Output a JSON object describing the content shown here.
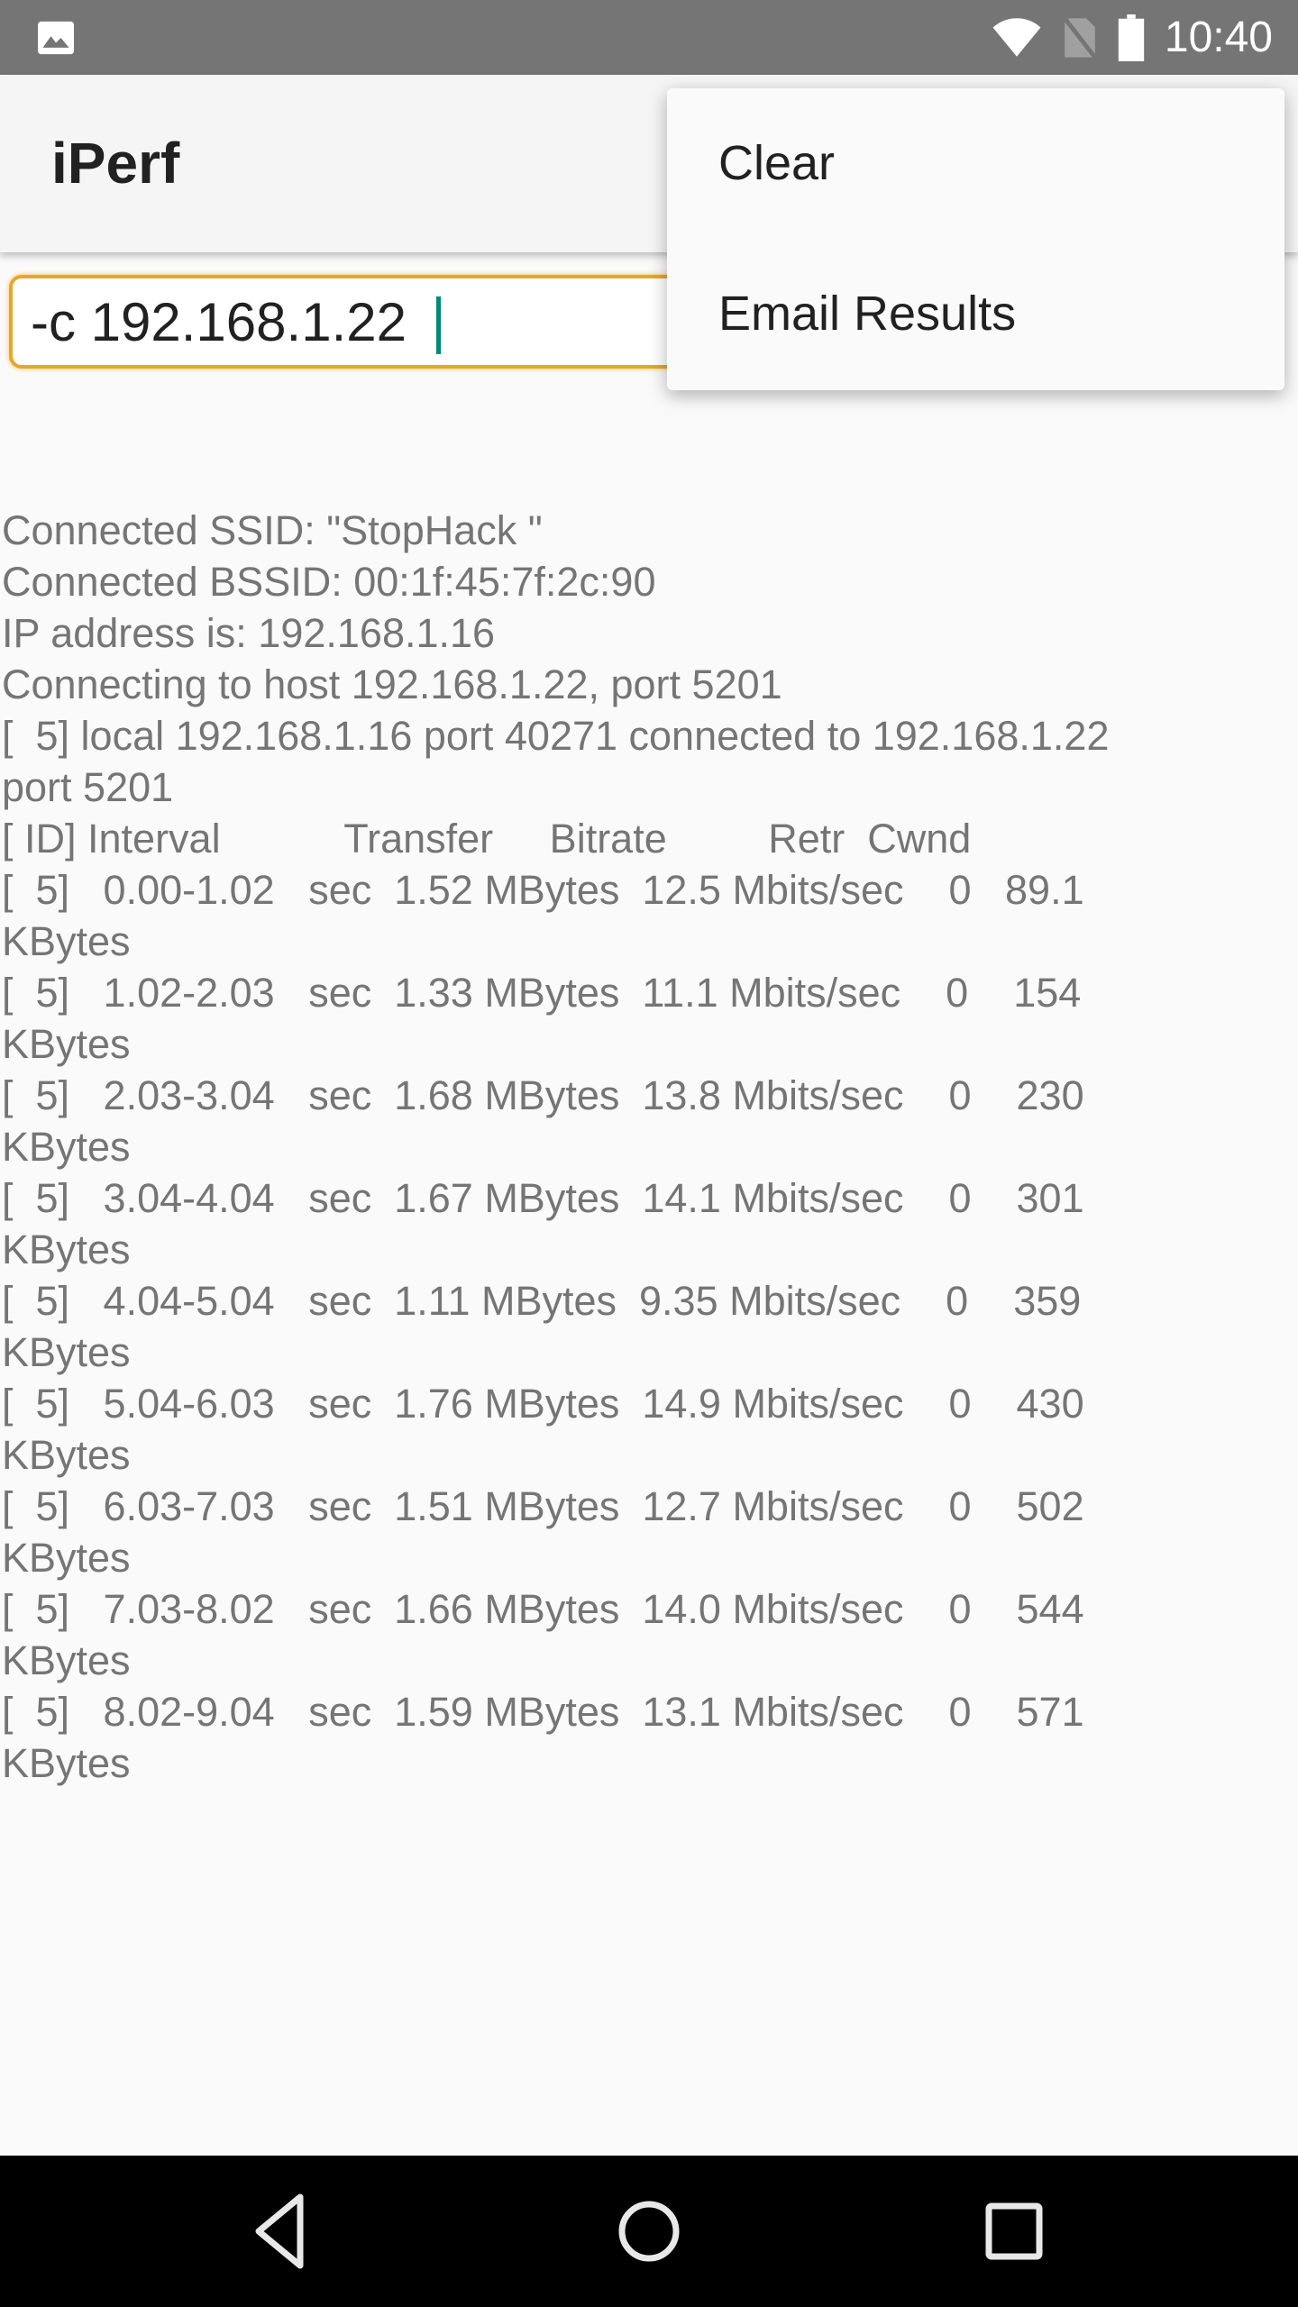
{
  "status_bar": {
    "time": "10:40",
    "icons": [
      "image-icon",
      "wifi-icon",
      "no-sim-icon",
      "battery-icon"
    ]
  },
  "app_bar": {
    "title": "iPerf"
  },
  "command_input": {
    "value": "-c 192.168.1.22 "
  },
  "overflow_menu": {
    "items": [
      {
        "label": "Clear"
      },
      {
        "label": "Email Results"
      }
    ]
  },
  "output": {
    "lines": [
      "Connected SSID: \"StopHack \"",
      "Connected BSSID: 00:1f:45:7f:2c:90",
      "IP address is: 192.168.1.16",
      "Connecting to host 192.168.1.22, port 5201",
      "[  5] local 192.168.1.16 port 40271 connected to 192.168.1.22",
      "port 5201",
      "[ ID] Interval           Transfer     Bitrate         Retr  Cwnd",
      "[  5]   0.00-1.02   sec  1.52 MBytes  12.5 Mbits/sec    0   89.1",
      "KBytes",
      "[  5]   1.02-2.03   sec  1.33 MBytes  11.1 Mbits/sec    0    154",
      "KBytes",
      "[  5]   2.03-3.04   sec  1.68 MBytes  13.8 Mbits/sec    0    230",
      "KBytes",
      "[  5]   3.04-4.04   sec  1.67 MBytes  14.1 Mbits/sec    0    301",
      "KBytes",
      "[  5]   4.04-5.04   sec  1.11 MBytes  9.35 Mbits/sec    0    359",
      "KBytes",
      "[  5]   5.04-6.03   sec  1.76 MBytes  14.9 Mbits/sec    0    430",
      "KBytes",
      "[  5]   6.03-7.03   sec  1.51 MBytes  12.7 Mbits/sec    0    502",
      "KBytes",
      "[  5]   7.03-8.02   sec  1.66 MBytes  14.0 Mbits/sec    0    544",
      "KBytes",
      "[  5]   8.02-9.04   sec  1.59 MBytes  13.1 Mbits/sec    0    571",
      "KBytes"
    ]
  },
  "colors": {
    "status_bar": "#757575",
    "input_border": "#e6a82a",
    "caret": "#00897b",
    "output_text": "#757575"
  },
  "nav_bar": {
    "buttons": [
      "back",
      "home",
      "recents"
    ]
  }
}
